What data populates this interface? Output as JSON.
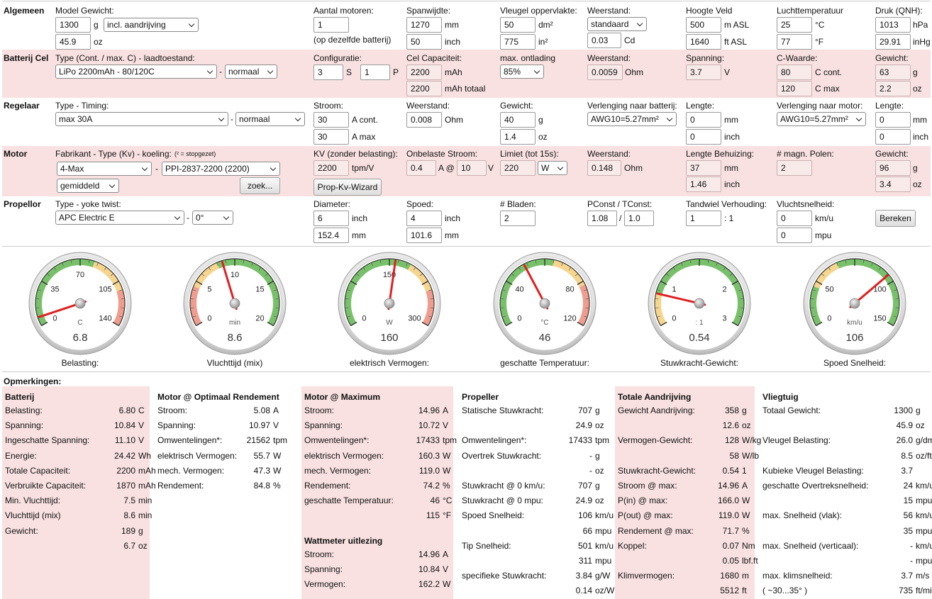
{
  "sections": {
    "algemeen": "Algemeen",
    "batterij": "Batterij Cel",
    "regelaar": "Regelaar",
    "motor": "Motor",
    "propellor": "Propellor"
  },
  "algemeen": {
    "model_label": "Model Gewicht:",
    "weight_g": "1300",
    "weight_unit_g": "g",
    "drive": "incl. aandrijving",
    "weight_oz": "45.9",
    "weight_unit_oz": "oz",
    "motors_label": "Aantal motoren:",
    "motors": "1",
    "motors_note": "(op dezelfde batterij)",
    "span_label": "Spanwijdte:",
    "span_mm": "1270",
    "span_mm_unit": "mm",
    "span_inch": "50",
    "span_inch_unit": "inch",
    "wing_label": "Vleugel oppervlakte:",
    "wing_dm2": "50",
    "wing_dm2_unit": "dm²",
    "wing_in2": "775",
    "wing_in2_unit": "in²",
    "drag_label": "Weerstand:",
    "drag": "standaard",
    "cd": "0.03",
    "cd_unit": "Cd",
    "alt_label": "Hoogte Veld",
    "alt_m": "500",
    "alt_m_unit": "m ASL",
    "alt_ft": "1640",
    "alt_ft_unit": "ft ASL",
    "temp_label": "Luchttemperatuur",
    "temp_c": "25",
    "temp_c_unit": "°C",
    "temp_f": "77",
    "temp_f_unit": "°F",
    "press_label": "Druk (QNH):",
    "press_hpa": "1013",
    "press_hpa_unit": "hPa",
    "press_inhg": "29.91",
    "press_inhg_unit": "inHg"
  },
  "batterij": {
    "type_label": "Type (Cont. / max. C) - laadtoestand:",
    "type": "LiPo 2200mAh - 80/120C",
    "state": "normaal",
    "config_label": "Configuratie:",
    "s": "3",
    "s_unit": "S",
    "p": "1",
    "p_unit": "P",
    "cap_label": "Cel Capaciteit:",
    "cap": "2200",
    "cap_unit": "mAh",
    "cap_total": "2200",
    "cap_total_unit": "mAh totaal",
    "disch_label": "max. ontlading",
    "disch": "85%",
    "res_label": "Weerstand:",
    "res": "0.0059",
    "res_unit": "Ohm",
    "volt_label": "Spanning:",
    "volt": "3.7",
    "volt_unit": "V",
    "c_label": "C-Waarde:",
    "c_cont": "80",
    "c_cont_unit": "C cont.",
    "c_max": "120",
    "c_max_unit": "C max",
    "w_label": "Gewicht:",
    "w_g": "63",
    "w_g_unit": "g",
    "w_oz": "2.2",
    "w_oz_unit": "oz"
  },
  "regelaar": {
    "type_label": "Type - Timing:",
    "type": "max 30A",
    "timing": "normaal",
    "cur_label": "Stroom:",
    "cur_cont": "30",
    "cur_cont_unit": "A cont.",
    "cur_max": "30",
    "cur_max_unit": "A max",
    "res_label": "Weerstand:",
    "res": "0.008",
    "res_unit": "Ohm",
    "w_label": "Gewicht:",
    "w_g": "40",
    "w_g_unit": "g",
    "w_oz": "1.4",
    "w_oz_unit": "oz",
    "ext_bat_label": "Verlenging naar batterij:",
    "ext_bat": "AWG10=5.27mm²",
    "len_label": "Lengte:",
    "len_mm": "0",
    "len_mm_unit": "mm",
    "len_inch": "0",
    "len_inch_unit": "inch",
    "ext_mot_label": "Verlenging naar motor:",
    "ext_mot": "AWG10=5.27mm²",
    "len2_label": "Lengte:",
    "len2_mm": "0",
    "len2_mm_unit": "mm",
    "len2_inch": "0",
    "len2_inch_unit": "inch"
  },
  "motor": {
    "type_label": "Fabrikant - Type (Kv) - koeling:",
    "type_note": "(² = stopgezet)",
    "maker": "4-Max",
    "model": "PPI-2837-2200 (2200)",
    "cooling": "gemiddeld",
    "search": "zoek...",
    "kv_label": "KV (zonder belasting):",
    "kv": "2200",
    "kv_unit": "tpm/V",
    "wizard": "Prop-Kv-Wizard",
    "idle_label": "Onbelaste Stroom:",
    "idle_a": "0.4",
    "at": "A @",
    "idle_v": "10",
    "idle_v_unit": "V",
    "limit_label": "Limiet (tot 15s):",
    "limit": "220",
    "limit_unit": "W",
    "res_label": "Weerstand:",
    "res": "0.148",
    "res_unit": "Ohm",
    "len_label": "Lengte Behuizing:",
    "len_mm": "37",
    "len_mm_unit": "mm",
    "len_inch": "1.46",
    "len_inch_unit": "inch",
    "poles_label": "# magn. Polen:",
    "poles": "2",
    "w_label": "Gewicht:",
    "w_g": "96",
    "w_g_unit": "g",
    "w_oz": "3.4",
    "w_oz_unit": "oz"
  },
  "propellor": {
    "type_label": "Type - yoke twist:",
    "type": "APC Electric E",
    "twist": "0°",
    "dia_label": "Diameter:",
    "dia_inch": "6",
    "dia_inch_unit": "inch",
    "dia_mm": "152.4",
    "dia_mm_unit": "mm",
    "pitch_label": "Spoed:",
    "pitch_inch": "4",
    "pitch_inch_unit": "inch",
    "pitch_mm": "101.6",
    "pitch_mm_unit": "mm",
    "blades_label": "# Bladen:",
    "blades": "2",
    "pconst_label": "PConst / TConst:",
    "pconst": "1.08",
    "slash": "/",
    "tconst": "1.0",
    "gear_label": "Tandwiel Verhouding:",
    "gear": "1",
    "gear_unit": ": 1",
    "speed_label": "Vluchtsnelheid:",
    "speed_kmh": "0",
    "speed_kmh_unit": "km/u",
    "speed_mph": "0",
    "speed_mph_unit": "mpu",
    "calc": "Bereken"
  },
  "gauges": [
    {
      "caption": "Belasting:",
      "value": "6.8",
      "unit": "C",
      "min": 0,
      "max": 140,
      "labels": [
        "0",
        "35",
        "70",
        "105",
        "140"
      ],
      "zones": [
        [
          "#78c16a",
          0,
          0.58
        ],
        [
          "#f6d58e",
          0.58,
          0.8
        ],
        [
          "#ee9d8e",
          0.8,
          1
        ]
      ]
    },
    {
      "caption": "Vluchttijd (mix)",
      "value": "8.6",
      "unit": "min",
      "min": 0,
      "max": 20,
      "labels": [
        "0",
        "5",
        "10",
        "15",
        "20"
      ],
      "zones": [
        [
          "#ee9d8e",
          0,
          0.22
        ],
        [
          "#f6d58e",
          0.22,
          0.4
        ],
        [
          "#78c16a",
          0.4,
          1
        ]
      ]
    },
    {
      "caption": "elektrisch Vermogen:",
      "value": "160",
      "unit": "W",
      "min": 0,
      "max": 300,
      "labels": [
        "0",
        "",
        "150",
        "",
        "300"
      ],
      "zones": [
        [
          "#78c16a",
          0,
          0.62
        ],
        [
          "#f6d58e",
          0.62,
          0.8
        ],
        [
          "#ee9d8e",
          0.8,
          1
        ]
      ]
    },
    {
      "caption": "geschatte Temperatuur:",
      "value": "46",
      "unit": "°C",
      "min": 0,
      "max": 120,
      "labels": [
        "0",
        "40",
        "",
        "80",
        "120"
      ],
      "zones": [
        [
          "#78c16a",
          0,
          0.55
        ],
        [
          "#f6d58e",
          0.55,
          0.77
        ],
        [
          "#ee9d8e",
          0.77,
          1
        ]
      ]
    },
    {
      "caption": "Stuwkracht-Gewicht:",
      "value": "0.54",
      "unit": ": 1",
      "min": 0,
      "max": 3,
      "labels": [
        "0",
        "1",
        "",
        "2",
        "3"
      ],
      "zones": [
        [
          "#f6d58e",
          0,
          0.18
        ],
        [
          "#78c16a",
          0.18,
          1
        ]
      ]
    },
    {
      "caption": "Spoed Snelheid:",
      "value": "106",
      "unit": "km/u",
      "min": 0,
      "max": 150,
      "labels": [
        "0",
        "50",
        "",
        "100",
        "150"
      ],
      "zones": [
        [
          "#78c16a",
          0,
          0.22
        ],
        [
          "#f6d58e",
          0.22,
          0.4
        ],
        [
          "#78c16a",
          0.4,
          1
        ]
      ]
    }
  ],
  "remarks_label": "Opmerkingen:",
  "results": {
    "batterij": {
      "title": "Batterij",
      "rows": [
        [
          "Belasting:",
          "6.80",
          "C"
        ],
        [
          "Spanning:",
          "10.84",
          "V"
        ],
        [
          "Ingeschatte Spanning:",
          "11.10",
          "V"
        ],
        [
          "Energie:",
          "24.42",
          "Wh"
        ],
        [
          "Totale Capaciteit:",
          "2200",
          "mAh"
        ],
        [
          "Verbruikte Capaciteit:",
          "1870",
          "mAh"
        ],
        [
          "Min. Vluchttijd:",
          "7.5",
          "min"
        ],
        [
          "Vluchttijd (mix)",
          "8.6",
          "min"
        ],
        [
          "Gewicht:",
          "189",
          "g"
        ],
        [
          "",
          "6.7",
          "oz"
        ]
      ]
    },
    "optimaal": {
      "title": "Motor @ Optimaal Rendement",
      "rows": [
        [
          "Stroom:",
          "5.08",
          "A"
        ],
        [
          "Spanning:",
          "10.97",
          "V"
        ],
        [
          "Omwentelingen*:",
          "21562",
          "tpm"
        ],
        [
          "elektrisch Vermogen:",
          "55.7",
          "W"
        ],
        [
          "mech. Vermogen:",
          "47.3",
          "W"
        ],
        [
          "Rendement:",
          "84.8",
          "%"
        ]
      ]
    },
    "maximum": {
      "title": "Motor @ Maximum",
      "rows": [
        [
          "Stroom:",
          "14.96",
          "A"
        ],
        [
          "Spanning:",
          "10.72",
          "V"
        ],
        [
          "Omwentelingen*:",
          "17433",
          "tpm"
        ],
        [
          "elektrisch Vermogen:",
          "160.3",
          "W"
        ],
        [
          "mech. Vermogen:",
          "119.0",
          "W"
        ],
        [
          "Rendement:",
          "74.2",
          "%"
        ],
        [
          "geschatte Temperatuur:",
          "46",
          "°C"
        ],
        [
          "",
          "115",
          "°F"
        ]
      ]
    },
    "wattmeter": {
      "title": "Wattmeter uitlezing",
      "rows": [
        [
          "Stroom:",
          "14.96",
          "A"
        ],
        [
          "Spanning:",
          "10.84",
          "V"
        ],
        [
          "Vermogen:",
          "162.2",
          "W"
        ]
      ]
    },
    "propeller": {
      "title": "Propeller",
      "rows": [
        [
          "Statische Stuwkracht:",
          "707",
          "g"
        ],
        [
          "",
          "24.9",
          "oz"
        ],
        [
          "Omwentelingen*:",
          "17433",
          "tpm"
        ],
        [
          "Overtrek Stuwkracht:",
          "-",
          "g"
        ],
        [
          "",
          "-",
          "oz"
        ],
        [
          "Stuwkracht @ 0 km/u:",
          "707",
          "g"
        ],
        [
          "Stuwkracht @ 0 mpu:",
          "24.9",
          "oz"
        ],
        [
          "Spoed Snelheid:",
          "106",
          "km/u"
        ],
        [
          "",
          "66",
          "mpu"
        ],
        [
          "Tip Snelheid:",
          "501",
          "km/u"
        ],
        [
          "",
          "311",
          "mpu"
        ],
        [
          "specifieke Stuwkracht:",
          "3.84",
          "g/W"
        ],
        [
          "",
          "0.14",
          "oz/W"
        ]
      ]
    },
    "totaal": {
      "title": "Totale Aandrijving",
      "rows": [
        [
          "Gewicht Aandrijving:",
          "358",
          "g"
        ],
        [
          "",
          "12.6",
          "oz"
        ],
        [
          "Vermogen-Gewicht:",
          "128",
          "W/kg"
        ],
        [
          "",
          "58",
          "W/lb"
        ],
        [
          "Stuwkracht-Gewicht:",
          "0.54",
          "1"
        ],
        [
          "Stroom @ max:",
          "14.96",
          "A"
        ],
        [
          "P(in) @ max:",
          "166.0",
          "W"
        ],
        [
          "P(out) @ max:",
          "119.0",
          "W"
        ],
        [
          "Rendement @ max:",
          "71.7",
          "%"
        ],
        [
          "Koppel:",
          "0.07",
          "Nm"
        ],
        [
          "",
          "0.05",
          "lbf.ft"
        ],
        [
          "Klimvermogen:",
          "1680",
          "m"
        ],
        [
          "",
          "5512",
          "ft"
        ]
      ]
    },
    "vliegtuig": {
      "title": "Vliegtuig",
      "rows": [
        [
          "Totaal Gewicht:",
          "1300",
          "g"
        ],
        [
          "",
          "45.9",
          "oz"
        ],
        [
          "Vleugel Belasting:",
          "26.0",
          "g/dm²"
        ],
        [
          "",
          "8.5",
          "oz/ft²"
        ],
        [
          "Kubieke Vleugel Belasting:",
          "3.7",
          ""
        ],
        [
          "geschatte Overtreksnelheid:",
          "24",
          "km/u"
        ],
        [
          "",
          "15",
          "mpu"
        ],
        [
          "max. Snelheid (vlak):",
          "56",
          "km/u"
        ],
        [
          "",
          "35",
          "mpu"
        ],
        [
          "max. Snelheid (verticaal):",
          "-",
          "km/u"
        ],
        [
          "",
          "-",
          "mpu"
        ],
        [
          "max. klimsnelheid:",
          "3.7",
          "m/s"
        ],
        [
          "( ~30...35° )",
          "735",
          "ft/min"
        ]
      ]
    }
  }
}
